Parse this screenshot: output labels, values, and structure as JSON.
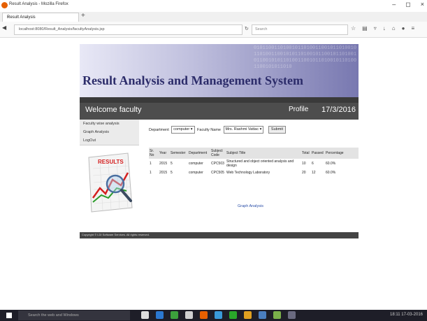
{
  "window": {
    "title": "Result Analysis - Mozilla Firefox",
    "minimize": "–",
    "maximize": "◻",
    "close": "×"
  },
  "tab": {
    "label": "Result Analysis",
    "close": "×",
    "new": "+"
  },
  "nav": {
    "url": "localhost:8080/Result_Analysis/facultyAnalysis.jsp",
    "search_placeholder": "Search"
  },
  "header": {
    "title": "Result Analysis and Management System",
    "binary": "0101100110100101101001100101101001011010011001010110100101100101101001011001010110100110010110100101101001100101011010"
  },
  "welcome": {
    "text": "Welcome faculty",
    "profile": "Profile",
    "date": "17/3/2016"
  },
  "sidebar": {
    "items": [
      "Faculty wise analysis",
      "Graph Analysis",
      "LogOut"
    ],
    "results_label": "RESULTS"
  },
  "filter": {
    "department_label": "Department",
    "department_value": "computer",
    "faculty_label": "Faculty Name",
    "faculty_value": "Mrs. Rashmi Vattac",
    "submit": "Submit"
  },
  "table": {
    "headers": [
      "Sr. No",
      "Year",
      "Semester",
      "Department",
      "Subject Code",
      "Subject Title",
      "Total",
      "Passed",
      "Percentage"
    ],
    "rows": [
      [
        "1",
        "2015",
        "5",
        "computer",
        "CPC503",
        "Structured and object oriented analysis and design",
        "10",
        "6",
        "60.0%"
      ],
      [
        "1",
        "2015",
        "5",
        "computer",
        "CPC505",
        "Web Technology Laboratory",
        "20",
        "12",
        "60.0%"
      ]
    ]
  },
  "graph_link": "Graph Analysis",
  "footer": "Copyright © LDI Software Services. All rights reserved.",
  "taskbar": {
    "search": "Search the web and Windows",
    "time": "18:11",
    "date": "17-03-2016"
  }
}
